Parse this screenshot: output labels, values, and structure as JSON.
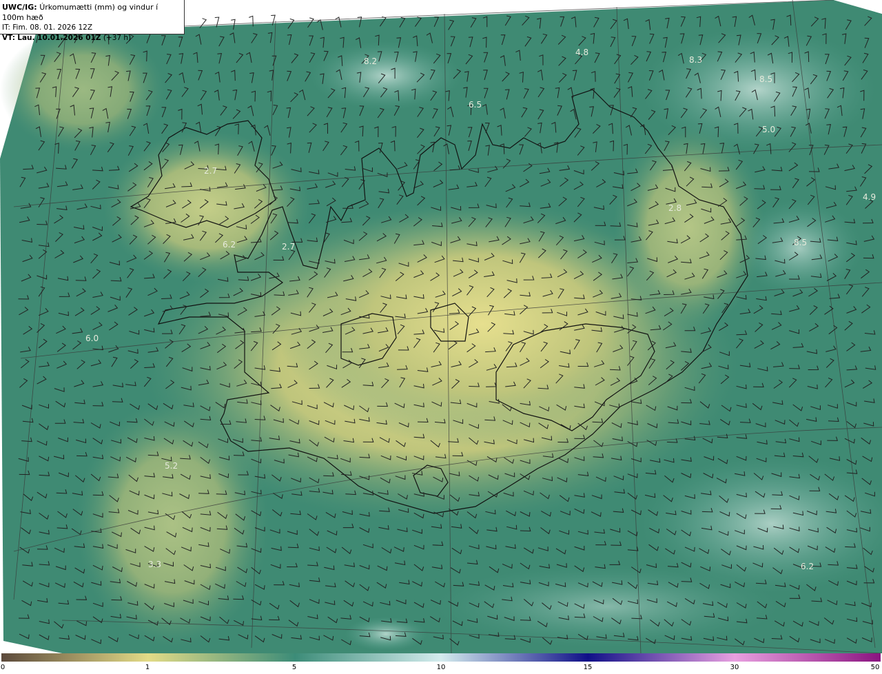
{
  "header": {
    "model": "UWC/IG:",
    "title": "Úrkomumætti (mm) og vindur í 100m hæð",
    "it_label": "IT:",
    "it_value": "Fim. 08. 01. 2026 12Z",
    "vt_label": "VT:",
    "vt_value": "Lau. 10.01.2026 01Z",
    "vt_offset": "(+37 h)"
  },
  "colorbar": {
    "ticks": [
      "0",
      "1",
      "5",
      "10",
      "15",
      "30",
      "50"
    ],
    "colors": [
      "#5c4a3c",
      "#e3db87",
      "#3c8c78",
      "#d4ecee",
      "#101088",
      "#e8a0e0",
      "#8a1480"
    ]
  },
  "map_values": [
    "8.2",
    "4.8",
    "8.3",
    "6.5",
    "5.0",
    "8.5",
    "2.7",
    "2.8",
    "4.9",
    "6.2",
    "2.7",
    "8.5",
    "6.0",
    "5.2",
    "3.3",
    "6.2"
  ]
}
